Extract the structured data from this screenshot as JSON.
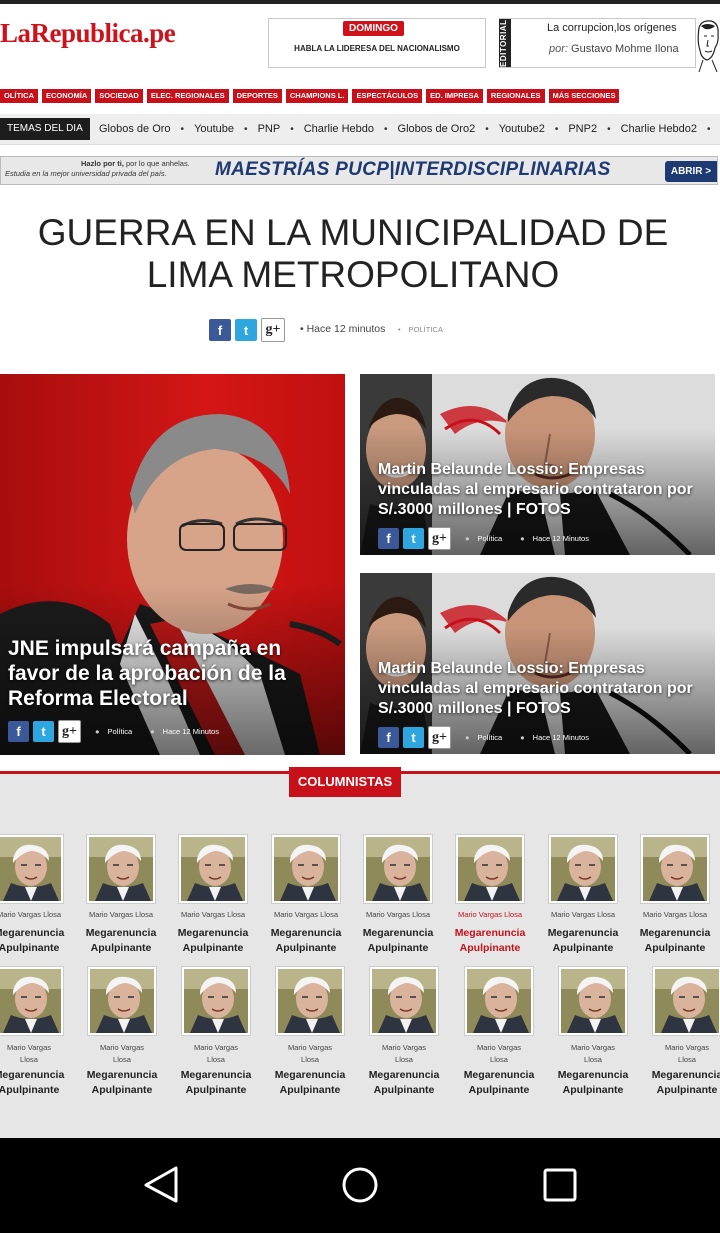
{
  "header": {
    "logo": "LaRepublica.pe",
    "domingo": {
      "badge": "DOMINGO",
      "text": "HABLA LA LIDERESA DEL NACIONALISMO"
    },
    "editorial": {
      "tag": "EDITORIAL",
      "title": "La corrupcion,los orígenes",
      "author_prefix": "por:",
      "author": "Gustavo Mohme Ilona"
    }
  },
  "nav": [
    "OLÍTICA",
    "ECONOMÍA",
    "SOCIEDAD",
    "ELEC. REGIONALES",
    "DEPORTES",
    "CHAMPIONS L.",
    "ESPECTÁCULOS",
    "ED. IMPRESA",
    "REGIONALES",
    "MÁS SECCIONES"
  ],
  "temas": {
    "label": "TEMAS DEL DIA",
    "items": [
      "Globos de Oro",
      "Youtube",
      "PNP",
      "Charlie Hebdo",
      "Globos de Oro2",
      "Youtube2",
      "PNP2",
      "Charlie Hebdo2"
    ]
  },
  "banner": {
    "line1_bold": "Hazlo por ti,",
    "line1_rest": " por lo que anhelas.",
    "line2": "Estudia en la mejor universidad privada del país.",
    "big_left": "MAESTRÍAS PUCP",
    "big_sep": "|",
    "big_right": "INTERDISCIPLINARIAS",
    "button": "ABRIR >"
  },
  "main": {
    "headline": "GUERRA EN LA MUNICIPALIDAD DE LIMA METROPOLITANO",
    "time": "Hace 12 minutos",
    "category": "POLÍTICA"
  },
  "share": {
    "fb": "f",
    "tw": "t",
    "gp": "g+"
  },
  "cards": [
    {
      "title": "JNE impulsará campaña en favor de la aprobación de la Reforma Electoral",
      "category": "Política",
      "time": "Hace 12 Minutos"
    },
    {
      "title": "Martin Belaunde Lossio: Empresas vinculadas al empresario contrataron por S/.3000 millones | FOTOS",
      "category": "Política",
      "time": "Hace 12 Minutos"
    },
    {
      "title": "Martin Belaunde Lossio: Empresas vinculadas al empresario contrataron por S/.3000 millones | FOTOS",
      "category": "Política",
      "time": "Hace 12 Minutos"
    }
  ],
  "columnistas": {
    "label": "COLUMNISTAS",
    "row1_name": "Mario Vargas Llosa",
    "row2_name_line1": "Mario Vargas",
    "row2_name_line2": "Llosa",
    "title_line1": "Megarenuncia",
    "title_line2": "Apulpinante"
  },
  "colors": {
    "brand_red": "#c8101a",
    "fb": "#3b5998",
    "tw": "#2ea7e0",
    "pucp_blue": "#1e3a73"
  }
}
